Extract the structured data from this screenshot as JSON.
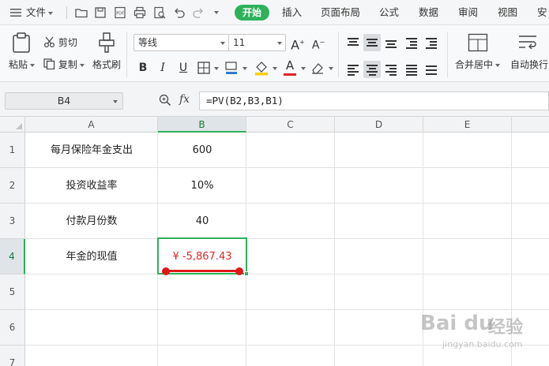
{
  "menubar": {
    "file_label": "文件",
    "tabs": [
      "开始",
      "插入",
      "页面布局",
      "公式",
      "数据",
      "审阅",
      "视图",
      "安"
    ],
    "active_tab": "开始",
    "accent_color": "#2eb15b"
  },
  "ribbon": {
    "paste_label": "粘贴",
    "cut_label": "剪切",
    "copy_label": "复制",
    "format_painter_label": "格式刷",
    "font_name": "等线",
    "font_size": "11",
    "bold": "B",
    "italic": "I",
    "underline": "U",
    "font_color_glyph": "A",
    "merge_center_label": "合并居中",
    "wrap_text_label": "自动换行"
  },
  "formula_bar": {
    "cell_ref": "B4",
    "fx_label": "fx",
    "formula": "=PV(B2,B3,B1)"
  },
  "sheet": {
    "columns": [
      "A",
      "B",
      "C",
      "D",
      "E"
    ],
    "rows": [
      "1",
      "2",
      "3",
      "4",
      "5",
      "6",
      "7"
    ],
    "selected_cell": "B4",
    "cells": {
      "A1": "每月保险年金支出",
      "B1": "600",
      "A2": "投资收益率",
      "B2": "10%",
      "A3": "付款月份数",
      "B3": "40",
      "A4": "年金的现值",
      "B4": "¥ -5,867.43"
    },
    "negative_color": "#e02424"
  },
  "watermark": {
    "brand": "Bai du",
    "cn": "经验",
    "url": "jingyan.baidu.com"
  }
}
